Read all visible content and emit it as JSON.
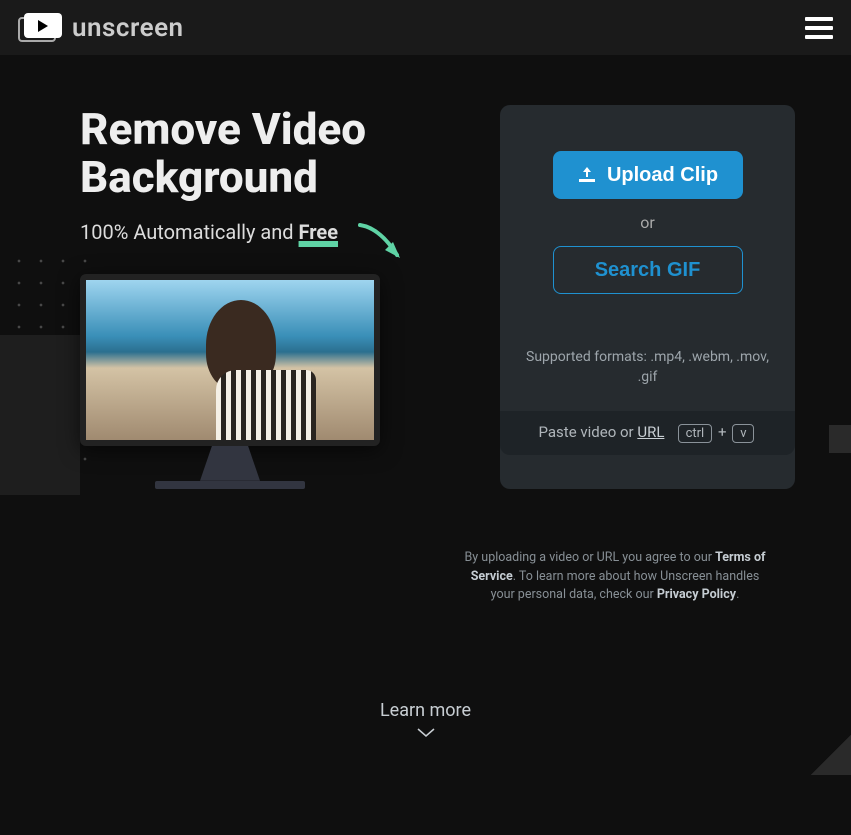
{
  "header": {
    "brand": "unscreen"
  },
  "hero": {
    "headline": "Remove Video Background",
    "subhead_prefix": "100% Automatically and ",
    "subhead_free": "Free"
  },
  "panel": {
    "upload_label": "Upload Clip",
    "or": "or",
    "search_label": "Search GIF",
    "supported": "Supported formats: .mp4, .webm, .mov, .gif",
    "paste_prefix": "Paste video or ",
    "paste_url": "URL",
    "key_ctrl": "ctrl",
    "plus": "+",
    "key_v": "v"
  },
  "legal": {
    "t1": "By uploading a video or URL you agree to our ",
    "tos": "Terms of Service",
    "t2": ". To learn more about how Unscreen handles your personal data, check our ",
    "pp": "Privacy Policy",
    "t3": "."
  },
  "learn_more": "Learn more"
}
